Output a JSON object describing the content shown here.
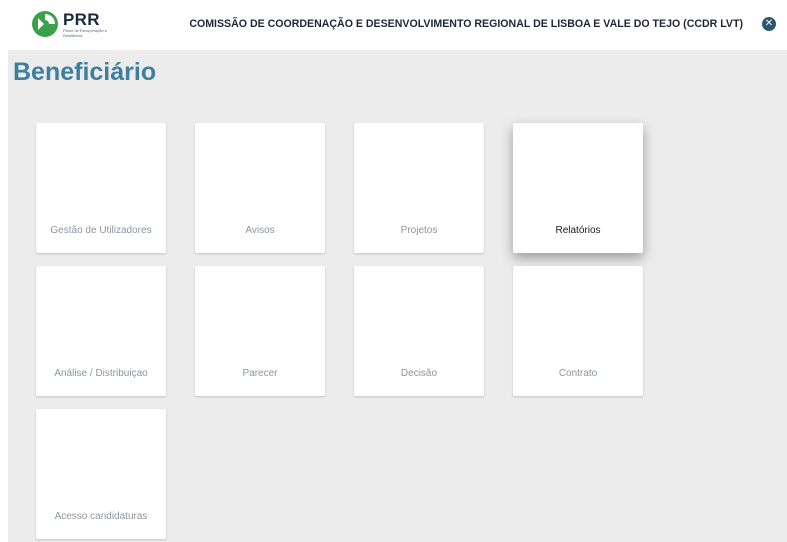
{
  "header": {
    "logo_title": "PRR",
    "logo_subtitle": "Plano de Recuperação e Resiliência",
    "organization": "COMISSÃO DE COORDENAÇÃO E DESENVOLVIMENTO REGIONAL DE LISBOA E VALE DO TEJO (CCDR LVT)",
    "close_icon": "✕"
  },
  "page": {
    "title": "Beneficiário"
  },
  "tiles": [
    {
      "label": "Gestão de Utilizadores"
    },
    {
      "label": "Avisos"
    },
    {
      "label": "Projetos"
    },
    {
      "label": "Relatórios"
    },
    {
      "label": "Análise / Distribuiçao"
    },
    {
      "label": "Parecer"
    },
    {
      "label": "Decisão"
    },
    {
      "label": "Contrato"
    },
    {
      "label": "Acesso candidaturas"
    }
  ],
  "colors": {
    "title": "#3e7fa0",
    "background": "#ececec",
    "logo_green": "#3aa14a"
  }
}
